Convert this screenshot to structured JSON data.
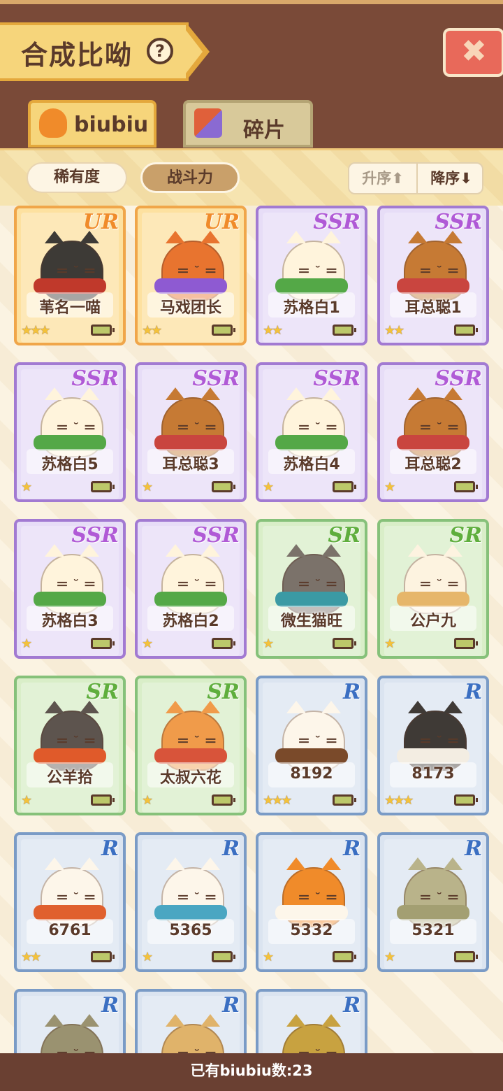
{
  "header": {
    "title": "合成比呦",
    "help_symbol": "?"
  },
  "tabs": [
    {
      "label": "biubiu",
      "active": true
    },
    {
      "label": "碎片",
      "active": false
    }
  ],
  "filters": {
    "rarity_label": "稀有度",
    "power_label": "战斗力",
    "asc_label": "升序",
    "desc_label": "降序"
  },
  "cards": [
    {
      "rarity": "UR",
      "name": "苇名一喵",
      "stars": 3,
      "theme": "#3d3a36",
      "scarf": "#c0392b"
    },
    {
      "rarity": "UR",
      "name": "马戏团长",
      "stars": 2,
      "theme": "#e8742f",
      "scarf": "#8e5ad2"
    },
    {
      "rarity": "SSR",
      "name": "苏格白1",
      "stars": 2,
      "theme": "#fff4dc",
      "scarf": "#54a847"
    },
    {
      "rarity": "SSR",
      "name": "耳总聪1",
      "stars": 2,
      "theme": "#c67a34",
      "scarf": "#c9453f"
    },
    {
      "rarity": "SSR",
      "name": "苏格白5",
      "stars": 1,
      "theme": "#fff4dc",
      "scarf": "#54a847"
    },
    {
      "rarity": "SSR",
      "name": "耳总聪3",
      "stars": 1,
      "theme": "#c67a34",
      "scarf": "#c9453f"
    },
    {
      "rarity": "SSR",
      "name": "苏格白4",
      "stars": 1,
      "theme": "#fff4dc",
      "scarf": "#54a847"
    },
    {
      "rarity": "SSR",
      "name": "耳总聪2",
      "stars": 1,
      "theme": "#c67a34",
      "scarf": "#c9453f"
    },
    {
      "rarity": "SSR",
      "name": "苏格白3",
      "stars": 1,
      "theme": "#fff4dc",
      "scarf": "#54a847"
    },
    {
      "rarity": "SSR",
      "name": "苏格白2",
      "stars": 1,
      "theme": "#fff4dc",
      "scarf": "#54a847"
    },
    {
      "rarity": "SR",
      "name": "微生猫旺",
      "stars": 1,
      "theme": "#7b726a",
      "scarf": "#3b9aa4"
    },
    {
      "rarity": "SR",
      "name": "公户九",
      "stars": 1,
      "theme": "#fdf3e0",
      "scarf": "#e6b66a"
    },
    {
      "rarity": "SR",
      "name": "公羊拾",
      "stars": 1,
      "theme": "#5d544e",
      "scarf": "#e05a2a"
    },
    {
      "rarity": "SR",
      "name": "太叔六花",
      "stars": 1,
      "theme": "#f09b4a",
      "scarf": "#d8543a"
    },
    {
      "rarity": "R",
      "name": "8192",
      "stars": 3,
      "theme": "#fdf6ea",
      "scarf": "#7a4a2a"
    },
    {
      "rarity": "R",
      "name": "8173",
      "stars": 3,
      "theme": "#3f3a36",
      "scarf": "#f3ede2"
    },
    {
      "rarity": "R",
      "name": "6761",
      "stars": 2,
      "theme": "#fdf6ea",
      "scarf": "#e0602e"
    },
    {
      "rarity": "R",
      "name": "5365",
      "stars": 1,
      "theme": "#fdf6ea",
      "scarf": "#4aa6c2"
    },
    {
      "rarity": "R",
      "name": "5332",
      "stars": 1,
      "theme": "#f08b2a",
      "scarf": "#fdf6ea"
    },
    {
      "rarity": "R",
      "name": "5321",
      "stars": 1,
      "theme": "#b9b38a",
      "scarf": "#a39f72"
    },
    {
      "rarity": "R",
      "name": "",
      "stars": 0,
      "theme": "#9a9270",
      "scarf": "#9a9270"
    },
    {
      "rarity": "R",
      "name": "",
      "stars": 0,
      "theme": "#e0b36a",
      "scarf": "#e0b36a"
    },
    {
      "rarity": "R",
      "name": "",
      "stars": 0,
      "theme": "#c8a240",
      "scarf": "#c8a240"
    }
  ],
  "footer": {
    "count_text": "已有biubiu数:23"
  },
  "colors": {
    "header_bg": "#7a4a38",
    "accent": "#f6d57b",
    "close_btn": "#e8695a"
  }
}
